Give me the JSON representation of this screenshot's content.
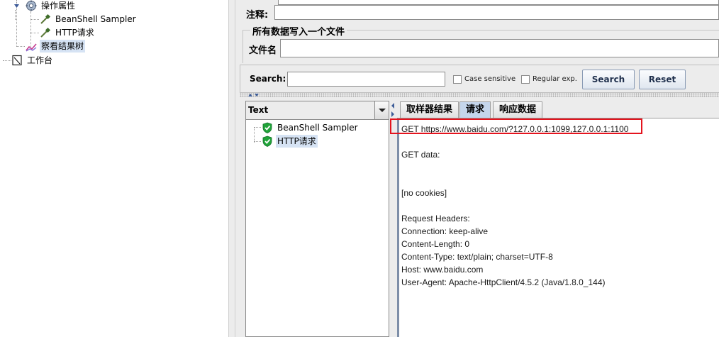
{
  "left_tree": {
    "items": [
      {
        "label": "操作属性",
        "icon": "gear-icon"
      },
      {
        "label": "BeanShell Sampler",
        "icon": "pipette-icon"
      },
      {
        "label": "HTTP请求",
        "icon": "pipette-icon"
      },
      {
        "label": "察看结果树",
        "icon": "graph-icon",
        "selected": true
      },
      {
        "label": "工作台",
        "icon": "workbench-icon"
      }
    ]
  },
  "form": {
    "comments_label": "注释:",
    "comments_value": "",
    "file_group_title": "所有数据写入一个文件",
    "filename_label": "文件名",
    "filename_value": ""
  },
  "search": {
    "label": "Search:",
    "value": "",
    "case_sensitive_label": "Case sensitive",
    "case_sensitive_checked": false,
    "regex_label": "Regular exp.",
    "regex_checked": false,
    "search_button": "Search",
    "reset_button": "Reset"
  },
  "results": {
    "renderer": "Text",
    "samples": [
      {
        "label": "BeanShell Sampler",
        "status": "success"
      },
      {
        "label": "HTTP请求",
        "status": "success",
        "selected": true
      }
    ]
  },
  "detail": {
    "tabs": [
      {
        "label": "取样器结果",
        "active": false
      },
      {
        "label": "请求",
        "active": true
      },
      {
        "label": "响应数据",
        "active": false
      }
    ],
    "lines": [
      "GET https://www.baidu.com/?127.0.0.1:1099,127.0.0.1:1100",
      "",
      "GET data:",
      "",
      "",
      "[no cookies]",
      "",
      "Request Headers:",
      "Connection: keep-alive",
      "Content-Length: 0",
      "Content-Type: text/plain; charset=UTF-8",
      "Host: www.baidu.com",
      "User-Agent: Apache-HttpClient/4.5.2 (Java/1.8.0_144)"
    ]
  },
  "colors": {
    "highlight_box": "#e4141e",
    "success_badge": "#21a339",
    "selection": "#d6e3f4"
  }
}
